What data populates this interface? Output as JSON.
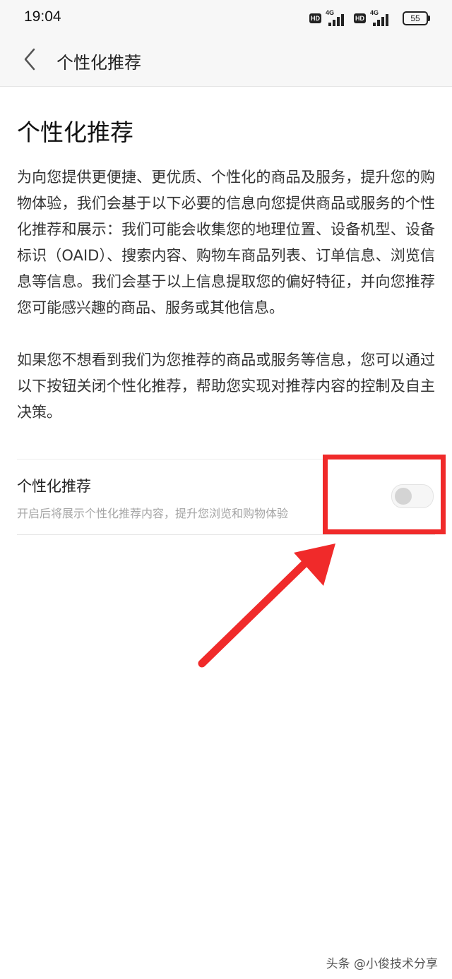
{
  "status_bar": {
    "time": "19:04",
    "hd_1": "HD",
    "net_1": "4G",
    "hd_2": "HD",
    "net_2": "4G",
    "battery": "55"
  },
  "nav": {
    "back_icon": "chevron-left-icon",
    "title": "个性化推荐"
  },
  "page": {
    "title": "个性化推荐",
    "paragraph_1": "为向您提供更便捷、更优质、个性化的商品及服务，提升您的购物体验，我们会基于以下必要的信息向您提供商品或服务的个性化推荐和展示：我们可能会收集您的地理位置、设备机型、设备标识（OAID）、搜索内容、购物车商品列表、订单信息、浏览信息等信息。我们会基于以上信息提取您的偏好特征，并向您推荐您可能感兴趣的商品、服务或其他信息。",
    "paragraph_2": "如果您不想看到我们为您推荐的商品或服务等信息，您可以通过以下按钮关闭个性化推荐，帮助您实现对推荐内容的控制及自主决策。"
  },
  "setting": {
    "title": "个性化推荐",
    "description": "开启后将展示个性化推荐内容，提升您浏览和购物体验",
    "enabled": false
  },
  "annotation": {
    "color": "#f02a2a"
  },
  "watermark": "头条 @小俊技术分享"
}
